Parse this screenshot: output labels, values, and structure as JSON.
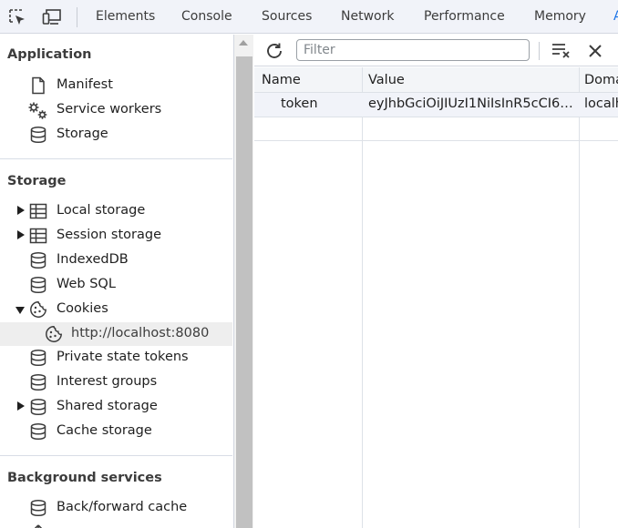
{
  "devtools_tabs": [
    "Elements",
    "Console",
    "Sources",
    "Network",
    "Performance",
    "Memory"
  ],
  "sidebar": {
    "application": {
      "title": "Application",
      "items": [
        {
          "label": "Manifest",
          "icon": "document-icon"
        },
        {
          "label": "Service workers",
          "icon": "gears-icon"
        },
        {
          "label": "Storage",
          "icon": "database-icon"
        }
      ]
    },
    "storage": {
      "title": "Storage",
      "items": [
        {
          "label": "Local storage",
          "icon": "table-icon",
          "expander": "collapsed"
        },
        {
          "label": "Session storage",
          "icon": "table-icon",
          "expander": "collapsed"
        },
        {
          "label": "IndexedDB",
          "icon": "database-icon"
        },
        {
          "label": "Web SQL",
          "icon": "database-icon"
        },
        {
          "label": "Cookies",
          "icon": "cookie-icon",
          "expander": "expanded"
        },
        {
          "label": "http://localhost:8080",
          "icon": "cookie-icon",
          "selected": true
        },
        {
          "label": "Private state tokens",
          "icon": "database-icon"
        },
        {
          "label": "Interest groups",
          "icon": "database-icon"
        },
        {
          "label": "Shared storage",
          "icon": "database-icon",
          "expander": "collapsed"
        },
        {
          "label": "Cache storage",
          "icon": "database-icon"
        }
      ]
    },
    "background": {
      "title": "Background services",
      "items": [
        {
          "label": "Back/forward cache",
          "icon": "database-icon"
        }
      ]
    }
  },
  "toolbar": {
    "filter_placeholder": "Filter",
    "filter_value": ""
  },
  "cookies_table": {
    "columns": [
      "Name",
      "Value",
      "Doma"
    ],
    "rows": [
      {
        "name": "token",
        "value": "eyJhbGciOiJIUzI1NiIsInR5cCI6…",
        "domain": "localh"
      }
    ]
  },
  "colors": {
    "tabbar_bg": "#f1f3f9",
    "selected_row_bg": "#eeeeee",
    "table_header_bg": "#f3f5f8",
    "accent": "#1a73e8"
  }
}
